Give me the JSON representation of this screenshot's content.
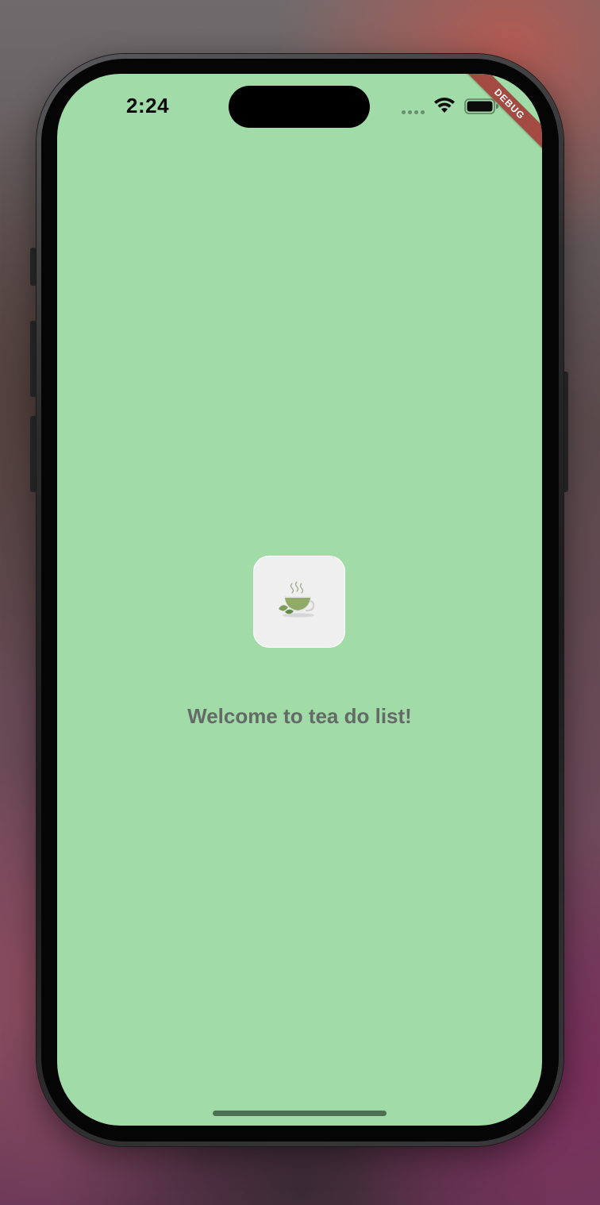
{
  "status_bar": {
    "time": "2:24",
    "icons": [
      "cellular-signal-icon",
      "wifi-icon",
      "battery-icon"
    ]
  },
  "debug_banner": {
    "label": "DEBUG",
    "color": "#a34b42"
  },
  "main": {
    "app_icon": "tea-cup-icon",
    "welcome_text": "Welcome to tea do list!"
  },
  "colors": {
    "screen_background": "#a0dba8",
    "welcome_text": "#646a66",
    "icon_tile": "#efefef",
    "tea": "#8fab67"
  }
}
